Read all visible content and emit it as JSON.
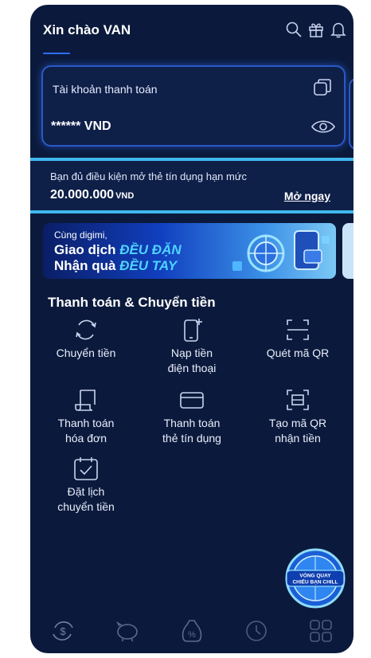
{
  "header": {
    "greeting": "Xin chào VAN",
    "icons": [
      "search-icon",
      "gift-icon",
      "bell-icon"
    ]
  },
  "account": {
    "title": "Tài khoản thanh toán",
    "balance": "****** VND"
  },
  "credit_offer": {
    "text": "Bạn đủ điều kiện mở thẻ tín dụng hạn mức",
    "amount": "20.000.000",
    "currency": "VND",
    "link": "Mở ngay"
  },
  "banner": {
    "line1": "Cùng digimi,",
    "line2_prefix": "Giao dịch ",
    "line2_highlight": "ĐỀU ĐẶN",
    "line3_prefix": "Nhận quà ",
    "line3_highlight": "ĐỀU TAY"
  },
  "services": {
    "title": "Thanh toán & Chuyển tiền",
    "items": [
      {
        "label1": "Chuyển tiền",
        "label2": ""
      },
      {
        "label1": "Nạp tiền",
        "label2": "điện thoại"
      },
      {
        "label1": "Quét mã QR",
        "label2": ""
      },
      {
        "label1": "Thanh toán",
        "label2": "hóa đơn"
      },
      {
        "label1": "Thanh toán",
        "label2": "thẻ tín dụng"
      },
      {
        "label1": "Tạo mã QR",
        "label2": "nhận tiền"
      },
      {
        "label1": "Đặt lịch",
        "label2": "chuyển tiền"
      }
    ]
  },
  "promo_wheel": {
    "line1": "VÒNG QUAY",
    "line2": "CHIẾU BẠN CHILL"
  },
  "bottom_nav": [
    "money-exchange-icon",
    "piggy-bank-icon",
    "discount-bag-icon",
    "history-icon",
    "apps-icon"
  ],
  "colors": {
    "background": "#0b1a3c",
    "accent": "#2f6cff",
    "highlight_border": "#3fb8ee"
  }
}
